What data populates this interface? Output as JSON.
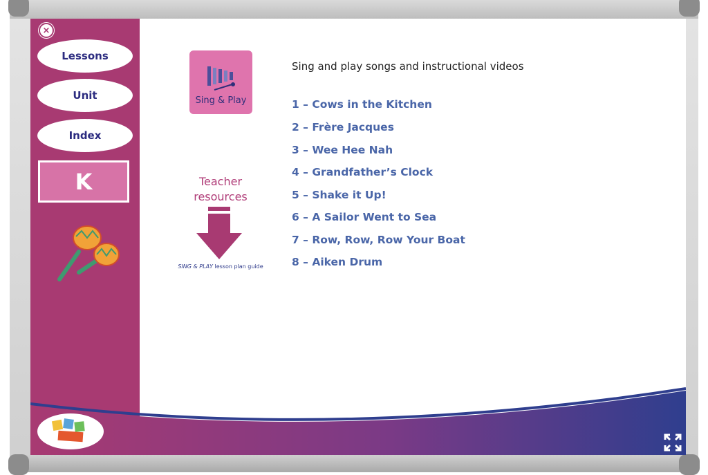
{
  "sidebar": {
    "close_label": "×",
    "buttons": [
      {
        "label": "Lessons"
      },
      {
        "label": "Unit"
      },
      {
        "label": "Index"
      }
    ],
    "grade_label": "K"
  },
  "main": {
    "sing_play_label": "Sing & Play",
    "teacher_resources_line1": "Teacher",
    "teacher_resources_line2": "resources",
    "guide_title": "SING & PLAY",
    "guide_rest": " lesson plan guide",
    "intro": "Sing and play songs and instructional videos",
    "songs": [
      "1 – Cows in the Kitchen",
      "2 – Frère Jacques",
      "3 – Wee Hee Nah",
      "4 – Grandfather’s Clock",
      "5 – Shake it Up!",
      "6 – A Sailor Went to Sea",
      "7 – Row, Row, Row Your Boat",
      "8 – Aiken Drum"
    ]
  },
  "icons": {
    "close": "close-icon",
    "xylophone": "xylophone-icon",
    "arrow": "download-arrow-icon",
    "maracas": "maracas-icon",
    "expand": "fullscreen-icon",
    "logo": "fun-music-logo"
  },
  "colors": {
    "sidebar": "#a83a72",
    "button_text": "#2c2c80",
    "song_link": "#4a66a8",
    "accent_pink": "#df74ad",
    "footer_blue": "#2f3e8e"
  }
}
